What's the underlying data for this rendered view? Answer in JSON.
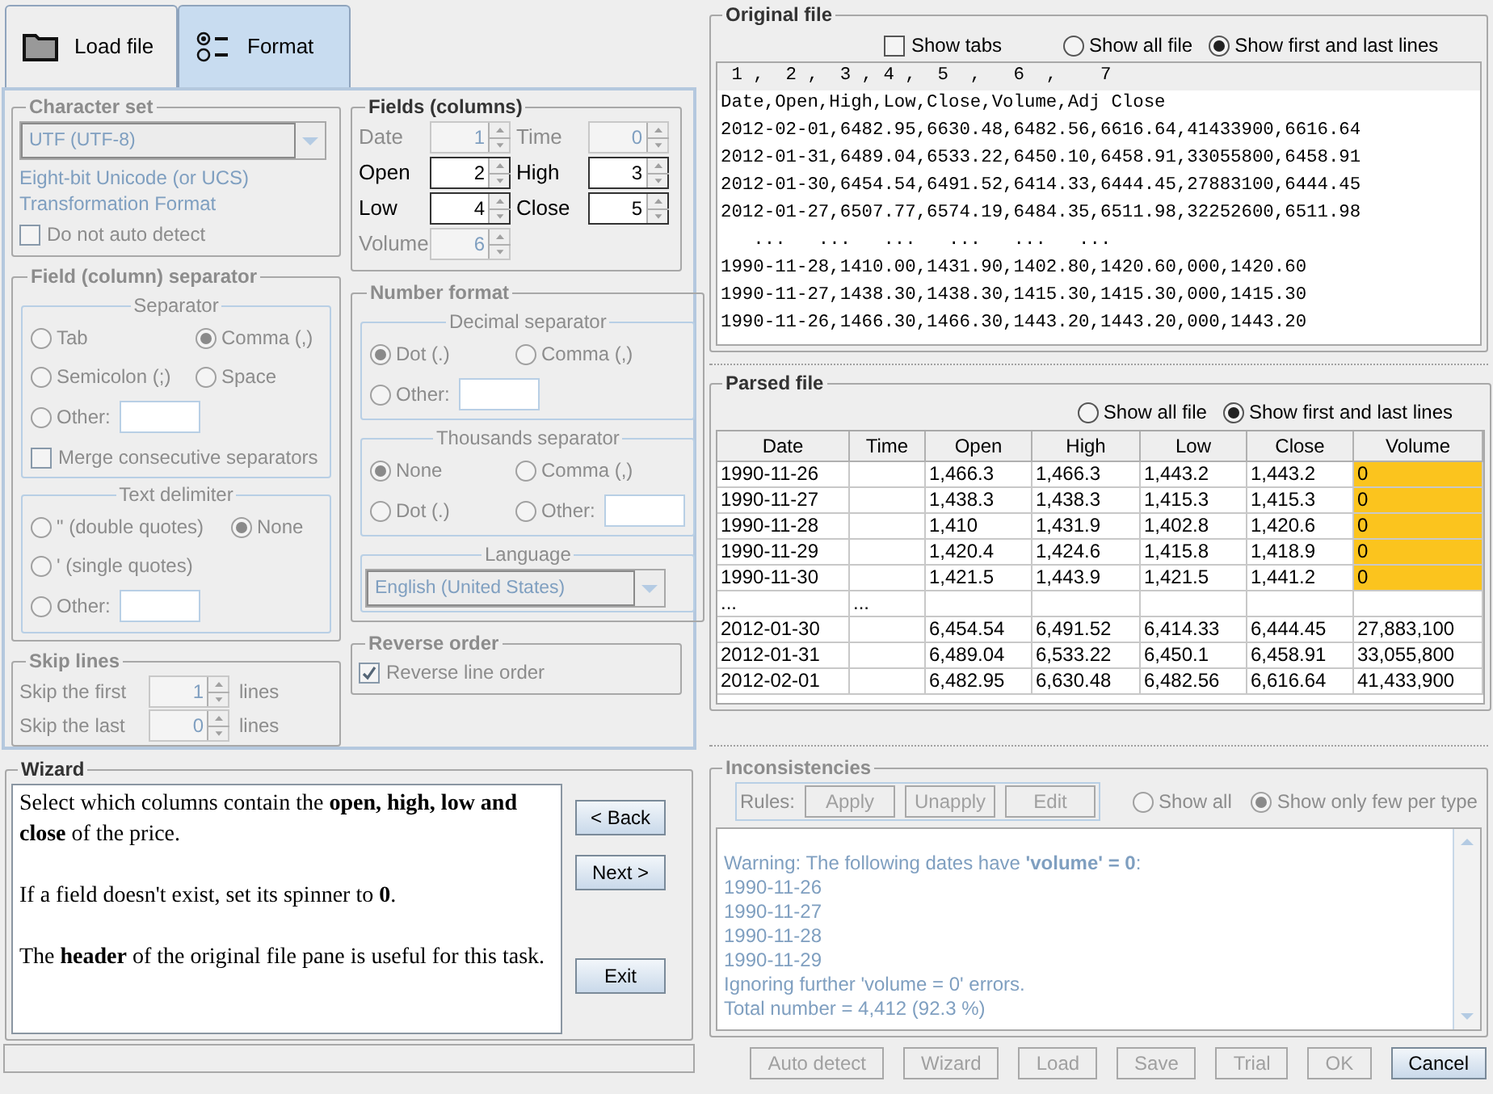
{
  "tabs": [
    {
      "label": "Load file",
      "kind": "folder",
      "selected": false
    },
    {
      "label": "Format",
      "kind": "options",
      "selected": true
    }
  ],
  "character_set": {
    "title": "Character set",
    "disabled": true,
    "value": "UTF (UTF-8)",
    "description": [
      "Eight-bit Unicode (or UCS)",
      "Transformation Format"
    ],
    "auto_detect": {
      "label": "Do not auto detect",
      "checked": false
    }
  },
  "fields": {
    "title": "Fields (columns)",
    "items": [
      {
        "label": "Date",
        "value": "1",
        "disabled": true
      },
      {
        "label": "Time",
        "value": "0",
        "disabled": true
      },
      {
        "label": "Open",
        "value": "2",
        "disabled": false
      },
      {
        "label": "High",
        "value": "3",
        "disabled": false
      },
      {
        "label": "Low",
        "value": "4",
        "disabled": false
      },
      {
        "label": "Close",
        "value": "5",
        "disabled": false
      },
      {
        "label": "Volume",
        "value": "6",
        "disabled": true
      }
    ]
  },
  "separator": {
    "title": "Field (column) separator",
    "disabled": true,
    "separator_group": {
      "title": "Separator",
      "rows": [
        [
          {
            "label": "Tab",
            "selected": false,
            "kind": "plain"
          },
          {
            "label": "Comma (,)",
            "selected": true,
            "kind": "plain"
          }
        ],
        [
          {
            "label": "Semicolon (;)",
            "selected": false,
            "kind": "plain"
          },
          {
            "label": "Space",
            "selected": false,
            "kind": "plain"
          }
        ],
        [
          {
            "label": "Other:",
            "selected": false,
            "kind": "other"
          }
        ]
      ],
      "merge": {
        "label": "Merge consecutive separators",
        "checked": false
      }
    },
    "delimiter_group": {
      "title": "Text delimiter",
      "rows": [
        [
          {
            "label": "\" (double quotes)",
            "selected": false,
            "kind": "plain"
          },
          {
            "label": "None",
            "selected": true,
            "kind": "plain"
          }
        ],
        [
          {
            "label": "' (single quotes)",
            "selected": false,
            "kind": "plain"
          }
        ],
        [
          {
            "label": "Other:",
            "selected": false,
            "kind": "other"
          }
        ]
      ]
    }
  },
  "number_format": {
    "title": "Number format",
    "disabled": true,
    "decimal_group": {
      "title": "Decimal separator",
      "rows": [
        [
          {
            "label": "Dot (.)",
            "selected": true,
            "kind": "plain"
          },
          {
            "label": "Comma (,)",
            "selected": false,
            "kind": "plain"
          }
        ],
        [
          {
            "label": "Other:",
            "selected": false,
            "kind": "other"
          }
        ]
      ]
    },
    "thousands_group": {
      "title": "Thousands separator",
      "rows": [
        [
          {
            "label": "None",
            "selected": true,
            "kind": "plain"
          },
          {
            "label": "Comma (,)",
            "selected": false,
            "kind": "plain"
          }
        ],
        [
          {
            "label": "Dot (.)",
            "selected": false,
            "kind": "plain"
          },
          {
            "label": "Other:",
            "selected": false,
            "kind": "other"
          }
        ]
      ]
    },
    "language_title": "Language",
    "language": "English (United States)"
  },
  "skip_lines": {
    "title": "Skip lines",
    "disabled": true,
    "rows": [
      {
        "label": "Skip the first",
        "value": "1",
        "unit": "lines"
      },
      {
        "label": "Skip the last",
        "value": "0",
        "unit": "lines"
      }
    ]
  },
  "reverse_order": {
    "title": "Reverse order",
    "disabled": true,
    "label": "Reverse line order",
    "checked": true
  },
  "wizard": {
    "title": "Wizard",
    "paragraphs": [
      "Select which columns contain the **open, high, low and close** of the price.",
      "If a field doesn't exist, set its spinner to **0**.",
      "The **header** of the original file pane is useful for this task."
    ],
    "buttons": [
      "< Back",
      "Next >",
      "Exit"
    ]
  },
  "original_file": {
    "title": "Original file",
    "show_tabs": {
      "label": "Show tabs",
      "checked": false
    },
    "modes": [
      {
        "label": "Show all file",
        "selected": false
      },
      {
        "label": "Show first and last lines",
        "selected": true
      }
    ],
    "header": " 1 ,  2 ,  3 , 4 ,  5  ,   6  ,    7",
    "lines": [
      "Date,Open,High,Low,Close,Volume,Adj Close",
      "2012-02-01,6482.95,6630.48,6482.56,6616.64,41433900,6616.64",
      "2012-01-31,6489.04,6533.22,6450.10,6458.91,33055800,6458.91",
      "2012-01-30,6454.54,6491.52,6414.33,6444.45,27883100,6444.45",
      "2012-01-27,6507.77,6574.19,6484.35,6511.98,32252600,6511.98",
      "   ...   ...   ...   ...   ...   ...",
      "1990-11-28,1410.00,1431.90,1402.80,1420.60,000,1420.60",
      "1990-11-27,1438.30,1438.30,1415.30,1415.30,000,1415.30",
      "1990-11-26,1466.30,1466.30,1443.20,1443.20,000,1443.20"
    ]
  },
  "parsed_file": {
    "title": "Parsed file",
    "modes": [
      {
        "label": "Show all file",
        "selected": false
      },
      {
        "label": "Show first and last lines",
        "selected": true
      }
    ],
    "columns": [
      "Date",
      "Time",
      "Open",
      "High",
      "Low",
      "Close",
      "Volume"
    ],
    "rows": [
      {
        "cells": [
          "1990-11-26",
          null,
          "1,466.3",
          "1,466.3",
          "1,443.2",
          "1,443.2",
          "0"
        ],
        "flagged": true
      },
      {
        "cells": [
          "1990-11-27",
          null,
          "1,438.3",
          "1,438.3",
          "1,415.3",
          "1,415.3",
          "0"
        ],
        "flagged": true
      },
      {
        "cells": [
          "1990-11-28",
          null,
          "1,410",
          "1,431.9",
          "1,402.8",
          "1,420.6",
          "0"
        ],
        "flagged": true
      },
      {
        "cells": [
          "1990-11-29",
          null,
          "1,420.4",
          "1,424.6",
          "1,415.8",
          "1,418.9",
          "0"
        ],
        "flagged": true
      },
      {
        "cells": [
          "1990-11-30",
          null,
          "1,421.5",
          "1,443.9",
          "1,421.5",
          "1,441.2",
          "0"
        ],
        "flagged": true
      },
      {
        "cells": [
          "...",
          "...",
          null,
          null,
          null,
          null,
          null
        ],
        "flagged": false
      },
      {
        "cells": [
          "2012-01-30",
          null,
          "6,454.54",
          "6,491.52",
          "6,414.33",
          "6,444.45",
          "27,883,100"
        ],
        "flagged": false
      },
      {
        "cells": [
          "2012-01-31",
          null,
          "6,489.04",
          "6,533.22",
          "6,450.1",
          "6,458.91",
          "33,055,800"
        ],
        "flagged": false
      },
      {
        "cells": [
          "2012-02-01",
          null,
          "6,482.95",
          "6,630.48",
          "6,482.56",
          "6,616.64",
          "41,433,900"
        ],
        "flagged": false
      }
    ]
  },
  "inconsistencies": {
    "title": "Inconsistencies",
    "disabled": true,
    "rules_label": "Rules:",
    "rule_buttons": [
      "Apply",
      "Unapply",
      "Edit"
    ],
    "modes": [
      {
        "label": "Show all",
        "selected": false
      },
      {
        "label": "Show only few per type",
        "selected": true
      }
    ],
    "lines": [
      "Warning: The following dates have **'volume' = 0**:",
      "1990-11-26",
      "1990-11-27",
      "1990-11-28",
      "1990-11-29",
      "Ignoring further 'volume = 0' errors.",
      "Total number = 4,412 (92.3 %)"
    ]
  },
  "footer_buttons": [
    {
      "label": "Auto detect",
      "disabled": true
    },
    {
      "label": "Wizard",
      "disabled": true
    },
    {
      "label": "Load",
      "disabled": true
    },
    {
      "label": "Save",
      "disabled": true
    },
    {
      "label": "Trial",
      "disabled": true
    },
    {
      "label": "OK",
      "disabled": true
    },
    {
      "label": "Cancel",
      "disabled": false
    }
  ]
}
